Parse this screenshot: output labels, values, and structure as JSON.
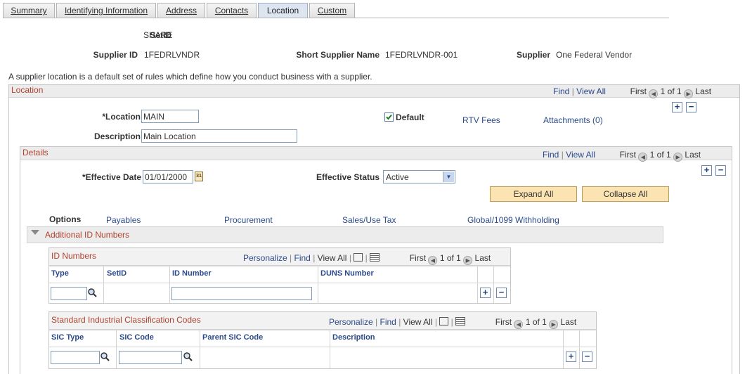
{
  "tabs": [
    {
      "label": "Summary",
      "active": false
    },
    {
      "label": "Identifying Information",
      "active": false
    },
    {
      "label": "Address",
      "active": false
    },
    {
      "label": "Contacts",
      "active": false
    },
    {
      "label": "Location",
      "active": true
    },
    {
      "label": "Custom",
      "active": false
    }
  ],
  "header": {
    "setid_label": "SetID",
    "setid_value": "SHARE",
    "supplier_id_label": "Supplier ID",
    "supplier_id_value": "1FEDRLVNDR",
    "short_name_label": "Short Supplier Name",
    "short_name_value": "1FEDRLVNDR-001",
    "supplier_label": "Supplier",
    "supplier_value": "One Federal Vendor"
  },
  "intro_text": "A supplier location is a default set of rules which define how you conduct business with a supplier.",
  "nav": {
    "find": "Find",
    "view_all": "View All",
    "first": "First",
    "last": "Last",
    "count": "1 of 1",
    "personalize": "Personalize"
  },
  "location": {
    "title": "Location",
    "location_label": "*Location",
    "location_value": "MAIN",
    "description_label": "Description",
    "description_value": "Main Location",
    "default_label": "Default",
    "default_checked": true,
    "rtv_fees": "RTV Fees",
    "attachments": "Attachments (0)"
  },
  "details": {
    "title": "Details",
    "eff_date_label": "*Effective Date",
    "eff_date_value": "01/01/2000",
    "eff_status_label": "Effective Status",
    "eff_status_value": "Active",
    "expand_all": "Expand All",
    "collapse_all": "Collapse All",
    "options_label": "Options",
    "options_links": [
      "Payables",
      "Procurement",
      "Sales/Use Tax",
      "Global/1099 Withholding"
    ],
    "additional_title": "Additional ID Numbers"
  },
  "id_numbers": {
    "title": "ID Numbers",
    "columns": [
      "Type",
      "SetID",
      "ID Number",
      "DUNS Number"
    ]
  },
  "sic": {
    "title": "Standard Industrial Classification Codes",
    "columns": [
      "SIC Type",
      "SIC Code",
      "Parent SIC Code",
      "Description"
    ]
  },
  "colors": {
    "link": "#2b4a8c",
    "section_title": "#b0422f",
    "button_bg": "#fbe3b2"
  }
}
